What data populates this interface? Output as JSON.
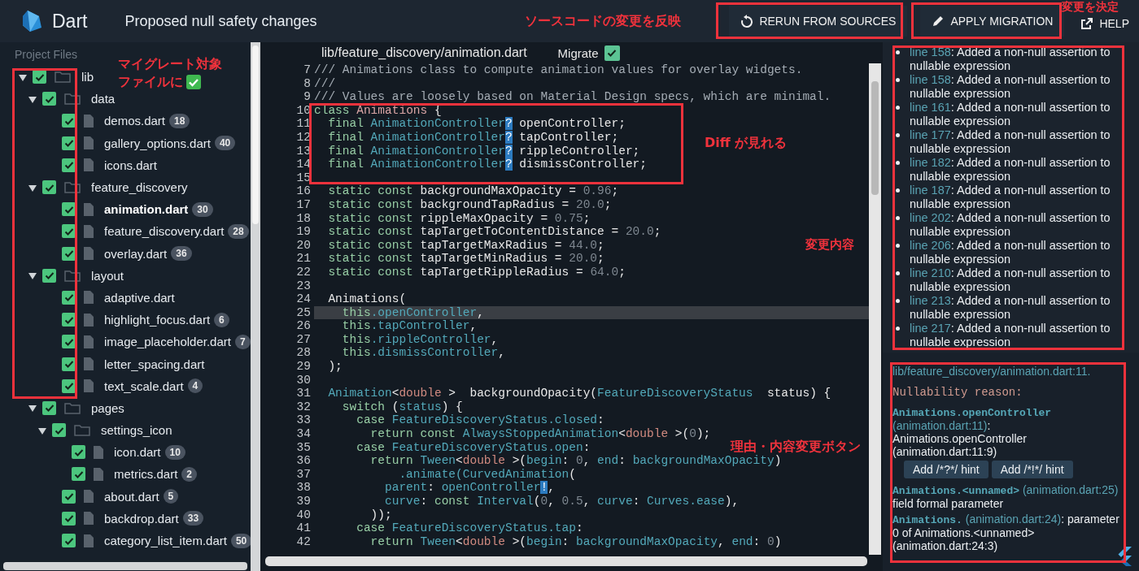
{
  "header": {
    "app_name": "Dart",
    "title": "Proposed null safety changes",
    "buttons": [
      {
        "kind": "rerun",
        "label": "RERUN FROM SOURCES"
      },
      {
        "kind": "apply",
        "label": "APPLY MIGRATION"
      },
      {
        "kind": "help",
        "label": "HELP"
      }
    ]
  },
  "project_files": {
    "heading": "Project Files",
    "items": [
      {
        "kind": "folder",
        "name": "lib",
        "checked": true,
        "expanded": true,
        "selected": false,
        "children": [
          {
            "kind": "folder",
            "name": "data",
            "checked": true,
            "expanded": true,
            "selected": false,
            "children": [
              {
                "kind": "file",
                "name": "demos.dart",
                "checked": true,
                "selected": false,
                "badge": "18"
              },
              {
                "kind": "file",
                "name": "gallery_options.dart",
                "checked": true,
                "selected": false,
                "badge": "40"
              },
              {
                "kind": "file",
                "name": "icons.dart",
                "checked": true,
                "selected": false
              }
            ]
          },
          {
            "kind": "folder",
            "name": "feature_discovery",
            "checked": true,
            "expanded": true,
            "selected": false,
            "children": [
              {
                "kind": "file",
                "name": "animation.dart",
                "checked": true,
                "selected": true,
                "badge": "30"
              },
              {
                "kind": "file",
                "name": "feature_discovery.dart",
                "checked": true,
                "selected": false,
                "badge": "28"
              },
              {
                "kind": "file",
                "name": "overlay.dart",
                "checked": true,
                "selected": false,
                "badge": "36"
              }
            ]
          },
          {
            "kind": "folder",
            "name": "layout",
            "checked": true,
            "expanded": true,
            "selected": false,
            "children": [
              {
                "kind": "file",
                "name": "adaptive.dart",
                "checked": true,
                "selected": false
              },
              {
                "kind": "file",
                "name": "highlight_focus.dart",
                "checked": true,
                "selected": false,
                "badge": "6"
              },
              {
                "kind": "file",
                "name": "image_placeholder.dart",
                "checked": true,
                "selected": false,
                "badge": "7"
              },
              {
                "kind": "file",
                "name": "letter_spacing.dart",
                "checked": true,
                "selected": false
              },
              {
                "kind": "file",
                "name": "text_scale.dart",
                "checked": true,
                "selected": false,
                "badge": "4"
              }
            ]
          },
          {
            "kind": "folder",
            "name": "pages",
            "checked": true,
            "expanded": true,
            "selected": false,
            "children": [
              {
                "kind": "folder",
                "name": "settings_icon",
                "checked": true,
                "expanded": true,
                "selected": false,
                "children": [
                  {
                    "kind": "file",
                    "name": "icon.dart",
                    "checked": true,
                    "selected": false,
                    "badge": "10"
                  },
                  {
                    "kind": "file",
                    "name": "metrics.dart",
                    "checked": true,
                    "selected": false,
                    "badge": "2"
                  }
                ]
              },
              {
                "kind": "file",
                "name": "about.dart",
                "checked": true,
                "selected": false,
                "badge": "5"
              },
              {
                "kind": "file",
                "name": "backdrop.dart",
                "checked": true,
                "selected": false,
                "badge": "33"
              },
              {
                "kind": "file",
                "name": "category_list_item.dart",
                "checked": true,
                "selected": false,
                "badge": "50"
              }
            ]
          }
        ]
      }
    ]
  },
  "editor": {
    "path": "lib/feature_discovery/animation.dart",
    "migrate_label": "Migrate",
    "migrate_checked": true,
    "lines": [
      {
        "number": "7",
        "selected": false,
        "tokens": [
          {
            "kind": "comment",
            "text": "/// Animations class to compute animation values for overlay widgets."
          }
        ]
      },
      {
        "number": "8",
        "selected": false,
        "tokens": [
          {
            "kind": "comment",
            "text": "///"
          }
        ]
      },
      {
        "number": "9",
        "selected": false,
        "tokens": [
          {
            "kind": "comment",
            "text": "/// Values are loosely based on Material Design specs, which are minimal."
          }
        ]
      },
      {
        "number": "10",
        "selected": false,
        "tokens": [
          {
            "kind": "keyword",
            "text": "class"
          },
          {
            "kind": "class",
            "text": " Animations"
          },
          {
            "kind": "plain",
            "text": " {"
          }
        ]
      },
      {
        "number": "11",
        "selected": false,
        "tokens": [
          {
            "kind": "keyword",
            "text": "  final"
          },
          {
            "kind": "type",
            "text": " AnimationController"
          },
          {
            "kind": "added",
            "text": "?"
          },
          {
            "kind": "plain",
            "text": " openController;"
          }
        ]
      },
      {
        "number": "12",
        "selected": false,
        "tokens": [
          {
            "kind": "keyword",
            "text": "  final"
          },
          {
            "kind": "type",
            "text": " AnimationController"
          },
          {
            "kind": "added",
            "text": "?"
          },
          {
            "kind": "plain",
            "text": " tapController;"
          }
        ]
      },
      {
        "number": "13",
        "selected": false,
        "tokens": [
          {
            "kind": "keyword",
            "text": "  final"
          },
          {
            "kind": "type",
            "text": " AnimationController"
          },
          {
            "kind": "added",
            "text": "?"
          },
          {
            "kind": "plain",
            "text": " rippleController;"
          }
        ]
      },
      {
        "number": "14",
        "selected": false,
        "tokens": [
          {
            "kind": "keyword",
            "text": "  final"
          },
          {
            "kind": "type",
            "text": " AnimationController"
          },
          {
            "kind": "added",
            "text": "?"
          },
          {
            "kind": "plain",
            "text": " dismissController;"
          }
        ]
      },
      {
        "number": "15",
        "selected": false
      },
      {
        "number": "16",
        "selected": false,
        "tokens": [
          {
            "kind": "keyword",
            "text": "  static const"
          },
          {
            "kind": "plain",
            "text": " backgroundMaxOpacity = "
          },
          {
            "kind": "number",
            "text": "0.96"
          },
          {
            "kind": "plain",
            "text": ";"
          }
        ]
      },
      {
        "number": "17",
        "selected": false,
        "tokens": [
          {
            "kind": "keyword",
            "text": "  static const"
          },
          {
            "kind": "plain",
            "text": " backgroundTapRadius = "
          },
          {
            "kind": "number",
            "text": "20.0"
          },
          {
            "kind": "plain",
            "text": ";"
          }
        ]
      },
      {
        "number": "18",
        "selected": false,
        "tokens": [
          {
            "kind": "keyword",
            "text": "  static const"
          },
          {
            "kind": "plain",
            "text": " rippleMaxOpacity = "
          },
          {
            "kind": "number",
            "text": "0.75"
          },
          {
            "kind": "plain",
            "text": ";"
          }
        ]
      },
      {
        "number": "19",
        "selected": false,
        "tokens": [
          {
            "kind": "keyword",
            "text": "  static const"
          },
          {
            "kind": "plain",
            "text": " tapTargetToContentDistance = "
          },
          {
            "kind": "number",
            "text": "20.0"
          },
          {
            "kind": "plain",
            "text": ";"
          }
        ]
      },
      {
        "number": "20",
        "selected": false,
        "tokens": [
          {
            "kind": "keyword",
            "text": "  static const"
          },
          {
            "kind": "plain",
            "text": " tapTargetMaxRadius = "
          },
          {
            "kind": "number",
            "text": "44.0"
          },
          {
            "kind": "plain",
            "text": ";"
          }
        ]
      },
      {
        "number": "21",
        "selected": false,
        "tokens": [
          {
            "kind": "keyword",
            "text": "  static const"
          },
          {
            "kind": "plain",
            "text": " tapTargetMinRadius = "
          },
          {
            "kind": "number",
            "text": "20.0"
          },
          {
            "kind": "plain",
            "text": ";"
          }
        ]
      },
      {
        "number": "22",
        "selected": false,
        "tokens": [
          {
            "kind": "keyword",
            "text": "  static const"
          },
          {
            "kind": "plain",
            "text": " tapTargetRippleRadius = "
          },
          {
            "kind": "number",
            "text": "64.0"
          },
          {
            "kind": "plain",
            "text": ";"
          }
        ]
      },
      {
        "number": "23",
        "selected": false
      },
      {
        "number": "24",
        "selected": false,
        "tokens": [
          {
            "kind": "plain",
            "text": "  Animations("
          }
        ]
      },
      {
        "number": "25",
        "selected": true,
        "tokens": [
          {
            "kind": "keyword",
            "text": "    this"
          },
          {
            "kind": "type",
            "text": ".openController"
          },
          {
            "kind": "plain",
            "text": ","
          }
        ]
      },
      {
        "number": "26",
        "selected": false,
        "tokens": [
          {
            "kind": "keyword",
            "text": "    this"
          },
          {
            "kind": "type",
            "text": ".tapController"
          },
          {
            "kind": "plain",
            "text": ","
          }
        ]
      },
      {
        "number": "27",
        "selected": false,
        "tokens": [
          {
            "kind": "keyword",
            "text": "    this"
          },
          {
            "kind": "type",
            "text": ".rippleController"
          },
          {
            "kind": "plain",
            "text": ","
          }
        ]
      },
      {
        "number": "28",
        "selected": false,
        "tokens": [
          {
            "kind": "keyword",
            "text": "    this"
          },
          {
            "kind": "type",
            "text": ".dismissController"
          },
          {
            "kind": "plain",
            "text": ","
          }
        ]
      },
      {
        "number": "29",
        "selected": false,
        "tokens": [
          {
            "kind": "plain",
            "text": "  );"
          }
        ]
      },
      {
        "number": "30",
        "selected": false
      },
      {
        "number": "31",
        "selected": false,
        "tokens": [
          {
            "kind": "type",
            "text": "  Animation"
          },
          {
            "kind": "plain",
            "text": "<"
          },
          {
            "kind": "primitive",
            "text": "double"
          },
          {
            "kind": "plain",
            "text": " >  backgroundOpacity("
          },
          {
            "kind": "type",
            "text": "FeatureDiscoveryStatus"
          },
          {
            "kind": "plain",
            "text": "  status) {"
          }
        ]
      },
      {
        "number": "32",
        "selected": false,
        "tokens": [
          {
            "kind": "keyword",
            "text": "    switch"
          },
          {
            "kind": "plain",
            "text": " ("
          },
          {
            "kind": "type",
            "text": "status"
          },
          {
            "kind": "plain",
            "text": ") {"
          }
        ]
      },
      {
        "number": "33",
        "selected": false,
        "tokens": [
          {
            "kind": "keyword",
            "text": "      case"
          },
          {
            "kind": "type",
            "text": " FeatureDiscoveryStatus.closed"
          },
          {
            "kind": "plain",
            "text": ":"
          }
        ]
      },
      {
        "number": "34",
        "selected": false,
        "tokens": [
          {
            "kind": "keyword",
            "text": "        return const"
          },
          {
            "kind": "type",
            "text": " AlwaysStoppedAnimation"
          },
          {
            "kind": "plain",
            "text": "<"
          },
          {
            "kind": "primitive",
            "text": "double"
          },
          {
            "kind": "plain",
            "text": " >("
          },
          {
            "kind": "number",
            "text": "0"
          },
          {
            "kind": "plain",
            "text": ");"
          }
        ]
      },
      {
        "number": "35",
        "selected": false,
        "tokens": [
          {
            "kind": "keyword",
            "text": "      case"
          },
          {
            "kind": "type",
            "text": " FeatureDiscoveryStatus.open"
          },
          {
            "kind": "plain",
            "text": ":"
          }
        ]
      },
      {
        "number": "36",
        "selected": false,
        "tokens": [
          {
            "kind": "keyword",
            "text": "        return"
          },
          {
            "kind": "type",
            "text": " Tween"
          },
          {
            "kind": "plain",
            "text": "<"
          },
          {
            "kind": "primitive",
            "text": "double"
          },
          {
            "kind": "plain",
            "text": " >("
          },
          {
            "kind": "type",
            "text": "begin"
          },
          {
            "kind": "plain",
            "text": ": "
          },
          {
            "kind": "number",
            "text": "0"
          },
          {
            "kind": "plain",
            "text": ", "
          },
          {
            "kind": "type",
            "text": "end"
          },
          {
            "kind": "plain",
            "text": ": "
          },
          {
            "kind": "type",
            "text": "backgroundMaxOpacity"
          },
          {
            "kind": "plain",
            "text": ")"
          }
        ]
      },
      {
        "number": "37",
        "selected": false,
        "tokens": [
          {
            "kind": "type",
            "text": "            .animate(CurvedAnimation"
          },
          {
            "kind": "plain",
            "text": "("
          }
        ]
      },
      {
        "number": "38",
        "selected": false,
        "tokens": [
          {
            "kind": "type",
            "text": "          parent"
          },
          {
            "kind": "plain",
            "text": ": "
          },
          {
            "kind": "type",
            "text": "openController"
          },
          {
            "kind": "added",
            "text": "!"
          },
          {
            "kind": "plain",
            "text": ","
          }
        ]
      },
      {
        "number": "39",
        "selected": false,
        "tokens": [
          {
            "kind": "type",
            "text": "          curve"
          },
          {
            "kind": "plain",
            "text": ": "
          },
          {
            "kind": "keyword",
            "text": "const"
          },
          {
            "kind": "type",
            "text": " Interval"
          },
          {
            "kind": "plain",
            "text": "("
          },
          {
            "kind": "number",
            "text": "0"
          },
          {
            "kind": "plain",
            "text": ", "
          },
          {
            "kind": "number",
            "text": "0.5"
          },
          {
            "kind": "plain",
            "text": ", "
          },
          {
            "kind": "type",
            "text": "curve"
          },
          {
            "kind": "plain",
            "text": ": "
          },
          {
            "kind": "type",
            "text": "Curves.ease"
          },
          {
            "kind": "plain",
            "text": "),"
          }
        ]
      },
      {
        "number": "40",
        "selected": false,
        "tokens": [
          {
            "kind": "plain",
            "text": "        ));"
          }
        ]
      },
      {
        "number": "41",
        "selected": false,
        "tokens": [
          {
            "kind": "keyword",
            "text": "      case"
          },
          {
            "kind": "type",
            "text": " FeatureDiscoveryStatus.tap"
          },
          {
            "kind": "plain",
            "text": ":"
          }
        ]
      },
      {
        "number": "42",
        "selected": false,
        "tokens": [
          {
            "kind": "keyword",
            "text": "        return"
          },
          {
            "kind": "type",
            "text": " Tween"
          },
          {
            "kind": "plain",
            "text": "<"
          },
          {
            "kind": "primitive",
            "text": "double"
          },
          {
            "kind": "plain",
            "text": " >("
          },
          {
            "kind": "type",
            "text": "begin"
          },
          {
            "kind": "plain",
            "text": ": "
          },
          {
            "kind": "type",
            "text": "backgroundMaxOpacity"
          },
          {
            "kind": "plain",
            "text": ", "
          },
          {
            "kind": "type",
            "text": "end"
          },
          {
            "kind": "plain",
            "text": ": "
          },
          {
            "kind": "number",
            "text": "0"
          },
          {
            "kind": "plain",
            "text": ")"
          }
        ]
      }
    ]
  },
  "edits": [
    {
      "link": "line 158",
      "text": ": Added a non-null assertion to nullable expression"
    },
    {
      "link": "line 158",
      "text": ": Added a non-null assertion to nullable expression"
    },
    {
      "link": "line 161",
      "text": ": Added a non-null assertion to nullable expression"
    },
    {
      "link": "line 177",
      "text": ": Added a non-null assertion to nullable expression"
    },
    {
      "link": "line 182",
      "text": ": Added a non-null assertion to nullable expression"
    },
    {
      "link": "line 187",
      "text": ": Added a non-null assertion to nullable expression"
    },
    {
      "link": "line 202",
      "text": ": Added a non-null assertion to nullable expression"
    },
    {
      "link": "line 206",
      "text": ": Added a non-null assertion to nullable expression"
    },
    {
      "link": "line 210",
      "text": ": Added a non-null assertion to nullable expression"
    },
    {
      "link": "line 213",
      "text": ": Added a non-null assertion to nullable expression"
    },
    {
      "link": "line 217",
      "text": ": Added a non-null assertion to nullable expression"
    }
  ],
  "details": {
    "location_link": "lib/feature_discovery/animation.dart:11.",
    "heading": "Nullability reason:",
    "reasons": [
      {
        "symbol": "Animations.openController",
        "location": "(animation.dart:11)",
        "text": ": Animations.openController (animation.dart:11:9)",
        "hints": [
          "Add /*?*/ hint",
          "Add /*!*/ hint"
        ]
      },
      {
        "symbol": "Animations.<unnamed>",
        "location": "(animation.dart:25)",
        "text": " field formal parameter"
      },
      {
        "symbol": "Animations.",
        "location": "(animation.dart:24)",
        "text": ": parameter 0 of Animations.<unnamed> (animation.dart:24:3)"
      }
    ]
  },
  "annotations": [
    {
      "text": "ソースコードの変更を反映"
    },
    {
      "text": "変更を決定"
    },
    {
      "text": "マイグレート対象"
    },
    {
      "text": "ファイルに"
    },
    {
      "text": "Diff が見れる"
    },
    {
      "text": "変更内容"
    },
    {
      "text": "理由・内容変更ボタン"
    }
  ]
}
